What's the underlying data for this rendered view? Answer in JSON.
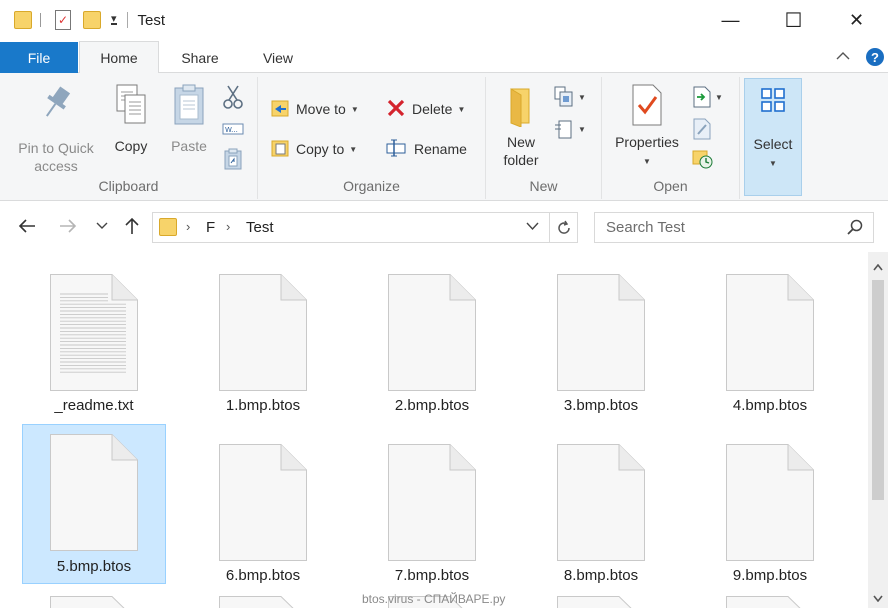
{
  "window": {
    "title": "Test",
    "controls": {
      "minimize": "—",
      "maximize": "☐",
      "close": "✕"
    }
  },
  "quick_access": {
    "dropdown_glyph": "▾"
  },
  "tabs": [
    {
      "label": "File"
    },
    {
      "label": "Home"
    },
    {
      "label": "Share"
    },
    {
      "label": "View"
    }
  ],
  "ribbon": {
    "clipboard": {
      "label": "Clipboard",
      "pin": "Pin to Quick\naccess",
      "copy": "Copy",
      "paste": "Paste"
    },
    "organize": {
      "label": "Organize",
      "move_to": "Move to",
      "copy_to": "Copy to",
      "delete": "Delete",
      "rename": "Rename"
    },
    "new": {
      "label": "New",
      "new_folder": "New\nfolder"
    },
    "open": {
      "label": "Open",
      "properties": "Properties"
    },
    "select": {
      "label": "Select"
    }
  },
  "address": {
    "crumbs": [
      "F",
      "Test"
    ],
    "search_placeholder": "Search Test"
  },
  "files": [
    {
      "name": "_readme.txt",
      "type": "text"
    },
    {
      "name": "1.bmp.btos",
      "type": "blank"
    },
    {
      "name": "2.bmp.btos",
      "type": "blank"
    },
    {
      "name": "3.bmp.btos",
      "type": "blank"
    },
    {
      "name": "4.bmp.btos",
      "type": "blank"
    },
    {
      "name": "5.bmp.btos",
      "type": "blank",
      "selected": true
    },
    {
      "name": "6.bmp.btos",
      "type": "blank"
    },
    {
      "name": "7.bmp.btos",
      "type": "blank"
    },
    {
      "name": "8.bmp.btos",
      "type": "blank"
    },
    {
      "name": "9.bmp.btos",
      "type": "blank"
    }
  ],
  "watermark": "btos.virus - СПАЙВАРЕ.ру",
  "colors": {
    "accent": "#1979ca",
    "selection_bg": "#cce8ff",
    "selection_border": "#99d1ff",
    "folder": "#f7d36a"
  }
}
